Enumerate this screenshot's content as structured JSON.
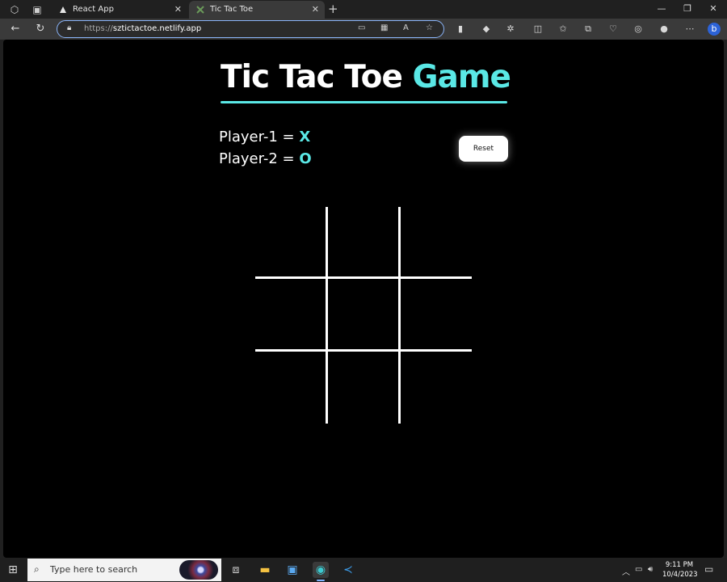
{
  "browser": {
    "tabs": [
      {
        "label": "React App",
        "active": false
      },
      {
        "label": "Tic Tac Toe",
        "active": true
      }
    ],
    "address_bar": {
      "scheme": "https://",
      "host": "sztictactoe.netlify.app"
    }
  },
  "page": {
    "title_main": "Tic Tac Toe",
    "title_accent": "Game",
    "player1_label": "Player-1 = ",
    "player1_mark": "X",
    "player2_label": "Player-2 = ",
    "player2_mark": "O",
    "reset_label": "Reset",
    "board": [
      "",
      "",
      "",
      "",
      "",
      "",
      "",
      "",
      ""
    ]
  },
  "taskbar": {
    "search_placeholder": "Type here to search",
    "time": "9:11 PM",
    "date": "10/4/2023"
  },
  "colors": {
    "accent": "#5ae8e6",
    "page_background": "#000000",
    "board_lines": "#ffffff"
  }
}
